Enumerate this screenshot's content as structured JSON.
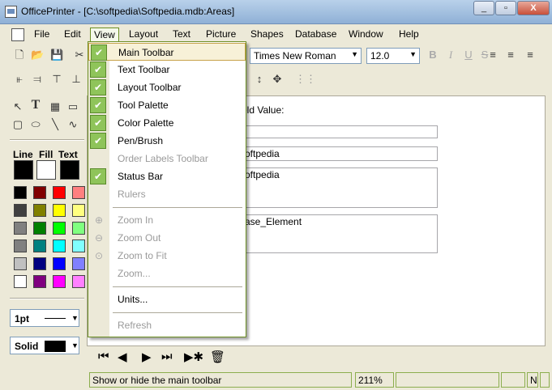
{
  "window": {
    "title": "OfficePrinter - [C:\\softpedia\\Softpedia.mdb:Areas]",
    "minimize_label": "_",
    "restore_label": "▫",
    "close_label": "X"
  },
  "menubar": {
    "items": [
      {
        "label": "File"
      },
      {
        "label": "Edit"
      },
      {
        "label": "View"
      },
      {
        "label": "Layout"
      },
      {
        "label": "Text"
      },
      {
        "label": "Picture"
      },
      {
        "label": "Shapes"
      },
      {
        "label": "Database"
      },
      {
        "label": "Window"
      },
      {
        "label": "Help"
      }
    ]
  },
  "text_toolbar": {
    "font_name": "Times New Roman",
    "font_size": "12.0",
    "bold": "B",
    "italic": "I",
    "underline": "U",
    "strike": "S"
  },
  "palette": {
    "line_label": "Line",
    "fill_label": "Fill",
    "text_label": "Text",
    "line_color": "#000000",
    "fill_color": "#ffffff",
    "text_color": "#000000",
    "swatches": [
      "#000000",
      "#800000",
      "#ff0000",
      "#ff8080",
      "#404040",
      "#808000",
      "#ffff00",
      "#ffff80",
      "#808080",
      "#008000",
      "#00ff00",
      "#80ff80",
      "#808080",
      "#008080",
      "#00ffff",
      "#80ffff",
      "#c0c0c0",
      "#000080",
      "#0000ff",
      "#8080ff",
      "#ffffff",
      "#800080",
      "#ff00ff",
      "#ff80ff"
    ],
    "line_width": "1pt",
    "fill_style": "Solid"
  },
  "canvas": {
    "field_label": "eld Value:",
    "field2": "oftpedia",
    "field3": "oftpedia",
    "field4": "ase_Element"
  },
  "view_menu": {
    "items": [
      {
        "label": "Main Toolbar",
        "checked": true
      },
      {
        "label": "Text Toolbar",
        "checked": true
      },
      {
        "label": "Layout Toolbar",
        "checked": true
      },
      {
        "label": "Tool Palette",
        "checked": true
      },
      {
        "label": "Color Palette",
        "checked": true
      },
      {
        "label": "Pen/Brush",
        "checked": true
      },
      {
        "label": "Order Labels Toolbar",
        "checked": false,
        "disabled": true
      },
      {
        "label": "Status Bar",
        "checked": true
      },
      {
        "label": "Rulers",
        "checked": false,
        "disabled": true
      },
      {
        "label": "Zoom In",
        "disabled": true
      },
      {
        "label": "Zoom Out",
        "disabled": true
      },
      {
        "label": "Zoom to Fit",
        "disabled": true
      },
      {
        "label": "Zoom...",
        "disabled": true
      },
      {
        "label": "Units..."
      },
      {
        "label": "Refresh",
        "disabled": true
      }
    ]
  },
  "statusbar": {
    "message": "Show or hide the main toolbar",
    "zoom": "211%",
    "num": "N"
  },
  "colors": {
    "accent": "#6b8e23",
    "check_bg": "#8fc45a"
  }
}
